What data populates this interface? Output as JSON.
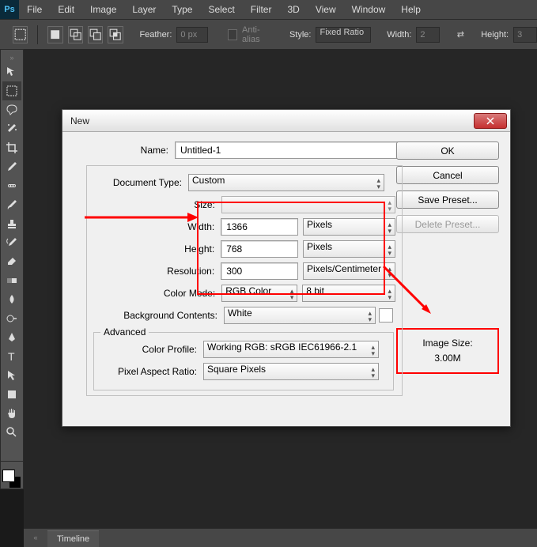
{
  "menubar": {
    "logo": "Ps",
    "items": [
      "File",
      "Edit",
      "Image",
      "Layer",
      "Type",
      "Select",
      "Filter",
      "3D",
      "View",
      "Window",
      "Help"
    ]
  },
  "optionsbar": {
    "feather_label": "Feather:",
    "feather_value": "0 px",
    "antialias_label": "Anti-alias",
    "style_label": "Style:",
    "style_value": "Fixed Ratio",
    "width_label": "Width:",
    "width_value": "2",
    "height_label": "Height:",
    "height_value": "3"
  },
  "timeline": {
    "tab": "Timeline"
  },
  "dialog": {
    "title": "New",
    "name_label": "Name:",
    "name_value": "Untitled-1",
    "doctype_label": "Document Type:",
    "doctype_value": "Custom",
    "size_label": "Size:",
    "size_value": "",
    "width_label": "Width:",
    "width_value": "1366",
    "width_unit": "Pixels",
    "height_label": "Height:",
    "height_value": "768",
    "height_unit": "Pixels",
    "resolution_label": "Resolution:",
    "resolution_value": "300",
    "resolution_unit": "Pixels/Centimeter",
    "colormode_label": "Color Mode:",
    "colormode_value": "RGB Color",
    "bitdepth_value": "8 bit",
    "bgcontents_label": "Background Contents:",
    "bgcontents_value": "White",
    "advanced_label": "Advanced",
    "colorprofile_label": "Color Profile:",
    "colorprofile_value": "Working RGB:  sRGB IEC61966-2.1",
    "par_label": "Pixel Aspect Ratio:",
    "par_value": "Square Pixels",
    "ok": "OK",
    "cancel": "Cancel",
    "save_preset": "Save Preset...",
    "delete_preset": "Delete Preset...",
    "image_size_label": "Image Size:",
    "image_size_value": "3.00M"
  }
}
